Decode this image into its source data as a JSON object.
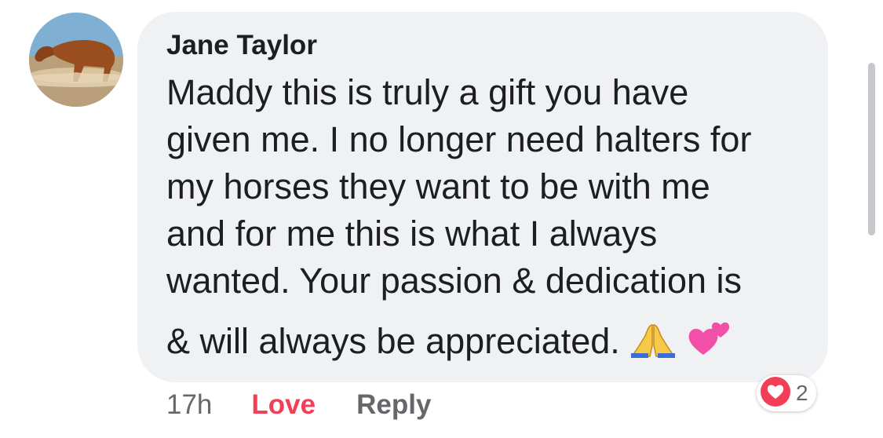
{
  "comment": {
    "author": "Jane Taylor",
    "avatar_icon": "horse-avatar",
    "text_lines": [
      "Maddy this is truly a gift you have",
      "given me. I no longer need halters for",
      "my horses they want to be with me",
      "and for me this is what I always",
      "wanted. Your passion & dedication is",
      "& will always be appreciated."
    ],
    "emojis": [
      "folded-hands-icon",
      "two-hearts-icon"
    ]
  },
  "actions": {
    "timestamp": "17h",
    "love_label": "Love",
    "reply_label": "Reply"
  },
  "reactions": {
    "icon": "love-reaction-icon",
    "count": "2"
  },
  "colors": {
    "bubble": "#f0f1f3",
    "love": "#f33e58",
    "secondary_text": "#65676b"
  }
}
